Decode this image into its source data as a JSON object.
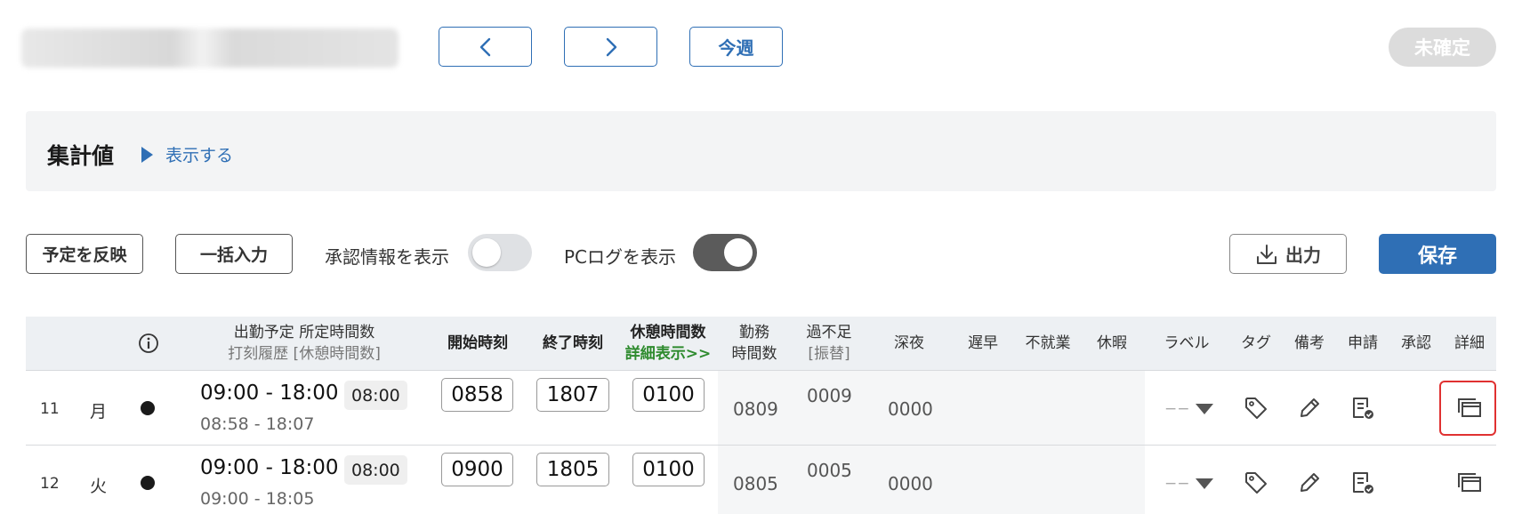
{
  "top_bar": {
    "prev_icon": "chevron-left-icon",
    "next_icon": "chevron-right-icon",
    "this_week_label": "今週",
    "status_label": "未確定"
  },
  "summary": {
    "title": "集計値",
    "toggle_label": "表示する"
  },
  "toolbar": {
    "apply_schedule_label": "予定を反映",
    "bulk_input_label": "一括入力",
    "show_approval_label": "承認情報を表示",
    "show_approval_on": false,
    "show_pclog_label": "PCログを表示",
    "show_pclog_on": true,
    "export_label": "出力",
    "save_label": "保存"
  },
  "table": {
    "headers": {
      "planned_line1": "出勤予定 所定時間数",
      "planned_line2": "打刻履歴 [休憩時間数]",
      "start_time": "開始時刻",
      "end_time": "終了時刻",
      "break_time": "休憩時間数",
      "break_detail_link": "詳細表示>>",
      "work_hours_line1": "勤務",
      "work_hours_line2": "時間数",
      "over_short_line1": "過不足",
      "over_short_line2": "[振替]",
      "late_night": "深夜",
      "late_early": "遅早",
      "absence": "不就業",
      "leave": "休暇",
      "label": "ラベル",
      "tag": "タグ",
      "note": "備考",
      "request": "申請",
      "approval": "承認",
      "detail": "詳細"
    },
    "rows": [
      {
        "day": "11",
        "weekday": "月",
        "schedule": "09:00 - 18:00",
        "scheduled_hours": "08:00",
        "punch": "08:58  - 18:07",
        "start": "0858",
        "end": "1807",
        "break": "0100",
        "work_hours": "0809",
        "over_short": "0009",
        "late_night": "0000",
        "label_value": "−−"
      },
      {
        "day": "12",
        "weekday": "火",
        "schedule": "09:00 - 18:00",
        "scheduled_hours": "08:00",
        "punch": "09:00  - 18:05",
        "start": "0900",
        "end": "1805",
        "break": "0100",
        "work_hours": "0805",
        "over_short": "0005",
        "late_night": "0000",
        "label_value": "−−"
      }
    ]
  },
  "colors": {
    "primary": "#2f6fb5",
    "detail_link": "#2e8b2e",
    "highlight": "#e03131"
  }
}
